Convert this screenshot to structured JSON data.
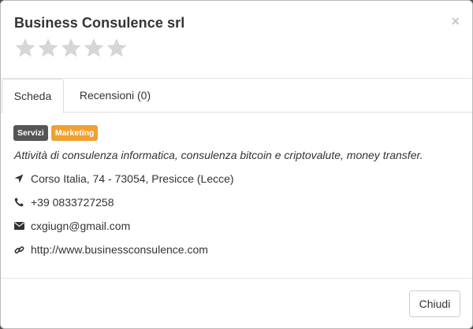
{
  "modal": {
    "title": "Business Consulence srl",
    "close_label": "×",
    "rating": 0,
    "rating_max": 5,
    "tabs": [
      {
        "label": "Scheda",
        "active": true
      },
      {
        "label": "Recensioni (0)",
        "active": false
      }
    ],
    "tags": [
      {
        "label": "Servizi",
        "color": "#555555"
      },
      {
        "label": "Marketing",
        "color": "#f0a030"
      }
    ],
    "description": "Attività di consulenza informatica, consulenza bitcoin e criptovalute, money transfer.",
    "address": "Corso Italia, 74 - 73054, Presicce (Lecce)",
    "phone": "+39 0833727258",
    "email": "cxgiugn@gmail.com",
    "website": "http://www.businessconsulence.com",
    "footer_button": "Chiudi"
  },
  "icons": {
    "address": "location-arrow-icon",
    "phone": "phone-icon",
    "email": "envelope-icon",
    "website": "link-icon",
    "rating": "star-icon"
  }
}
